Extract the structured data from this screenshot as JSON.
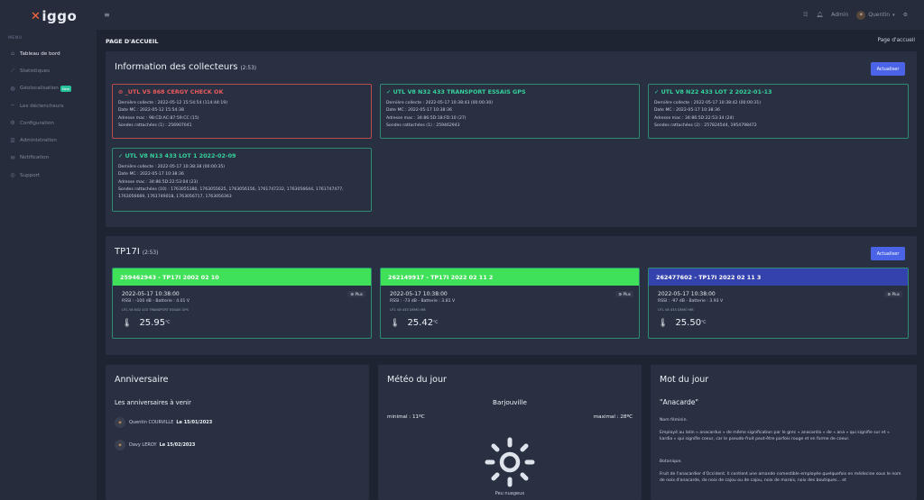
{
  "sidebar": {
    "logo": "iggo",
    "section_label": "MENU",
    "items": [
      {
        "label": "Tableau de bord",
        "icon": "home-icon",
        "badge": ""
      },
      {
        "label": "Statistiques",
        "icon": "chart-icon",
        "badge": ""
      },
      {
        "label": "Géolocalisation",
        "icon": "globe-icon",
        "badge": "New"
      },
      {
        "label": "Les déclencheurs",
        "icon": "wifi-icon",
        "badge": ""
      },
      {
        "label": "Configuration",
        "icon": "gear-icon",
        "badge": ""
      },
      {
        "label": "Administration",
        "icon": "admin-icon",
        "badge": ""
      },
      {
        "label": "Notification",
        "icon": "mail-icon",
        "badge": ""
      },
      {
        "label": "Support",
        "icon": "support-icon",
        "badge": ""
      }
    ]
  },
  "topbar": {
    "admin_label": "Admin",
    "user_name": "Quentin"
  },
  "page": {
    "title": "PAGE D'ACCUEIL",
    "breadcrumb": "Page d'accueil"
  },
  "collectors": {
    "title": "Information des collecteurs",
    "count": "(2:53)",
    "refresh_label": "Actualiser",
    "items": [
      {
        "status": "error",
        "name": "_UTL V5 868 CERGY CHECK OK",
        "last": "Dernière collecte : 2022-05-12 15:54:54 (114:44:19)",
        "date_mc": "Date MC : 2022-05-12 15:54:38",
        "mac": "Adresse mac : 98:CD:AC:87:59:CC (15)",
        "probes": "Sondes rattachées (1) : 256907041"
      },
      {
        "status": "ok",
        "name": "UTL V8 N32 433 TRANSPORT ESSAIS GPS",
        "last": "Dernière collecte : 2022-05-17 10:38:43 (00:00:30)",
        "date_mc": "Date MC : 2022-05-17 10:38:36",
        "mac": "Adresse mac : 34:86:5D:18:FD:10 (27)",
        "probes": "Sondes rattachées (1) : 259462943"
      },
      {
        "status": "ok",
        "name": "UTL V8 N22 433 LOT 2 2022-01-13",
        "last": "Dernière collecte : 2022-05-17 10:38:42 (00:00:31)",
        "date_mc": "Date MC : 2022-05-17 10:38:36",
        "mac": "Adresse mac : 34:86:5D:22:53:34 (24)",
        "probes": "Sondes rattachées (2) : 257824544, 1954798472"
      },
      {
        "status": "ok",
        "name": "UTL V8 N13 433 LOT 1 2022-02-09",
        "last": "Dernière collecte : 2022-05-17 10:38:38 (00:00:35)",
        "date_mc": "Date MC : 2022-05-17 10:38:36",
        "mac": "Adresse mac : 34:86:5D:22:53:04 (23)",
        "probes": "Sondes rattachées (10) : 1763055380, 1763055625, 1763056156, 1761747232, 1763056644, 1761747477, 1763056669, 1761749018, 1763056717, 1763056363"
      }
    ]
  },
  "tp": {
    "title": "TP17I",
    "count": "(2:53)",
    "refresh_label": "Actualiser",
    "plus_label": "Plus",
    "items": [
      {
        "name": "259462943 - TP17I 2002 02 10",
        "color": "#3fe158",
        "date": "2022-05-17 10:38:00",
        "rssi": "RSSI : -100 dB - Batterie : 4.01 V",
        "collector": "UTL V8 N32 433 TRANSPORT ESSAIS GPS",
        "temp": "25.95",
        "unit": "°C"
      },
      {
        "name": "262149917 - TP17I 2022 02 11 2",
        "color": "#3fe158",
        "date": "2022-05-17 10:38:00",
        "rssi": "RSSI : -73 dB - Batterie : 3.81 V",
        "collector": "UTL V8 433 DEMO MB",
        "temp": "25.42",
        "unit": "°C"
      },
      {
        "name": "262477602 - TP17I 2022 02 11 3",
        "color": "#3442ad",
        "date": "2022-05-17 10:38:00",
        "rssi": "RSSI : -97 dB - Batterie : 3.93 V",
        "collector": "UTL V8 433 DEMO MB",
        "temp": "25.50",
        "unit": "°C"
      }
    ]
  },
  "birthday": {
    "title": "Anniversaire",
    "subtitle": "Les anniversaires à venir",
    "items": [
      {
        "name": "Quentin COURVILLE",
        "date": "Le 15/01/2023"
      },
      {
        "name": "Davy LEROY",
        "date": "Le 15/02/2023"
      }
    ]
  },
  "meteo": {
    "title": "Météo du jour",
    "city": "Barjouville",
    "min": "minimal : 11ºC",
    "max": "maximal : 28ºC",
    "desc": "Peu nuageux",
    "icon": "sun-icon"
  },
  "mot": {
    "title": "Mot du jour",
    "word": "\"Anacarde\"",
    "gender": "Nom féminin.",
    "def1": "Employé au latin « anacardus » de même signification par le grec « anacardis » de « ana » qui signifie sur et « kardia » qui signifie coeur, car le pseudo-fruit peut-être parfois rouge et en forme de coeur.",
    "domain": "Botanique.",
    "def2": "Fruit de l'anacardier d'Occident. Il contient une amande comestible employée quelquefois en médecine sous le nom de noix d'anacarde, de noix de cajou ou de cajou, noix de marais, noix des boutiques... et"
  }
}
